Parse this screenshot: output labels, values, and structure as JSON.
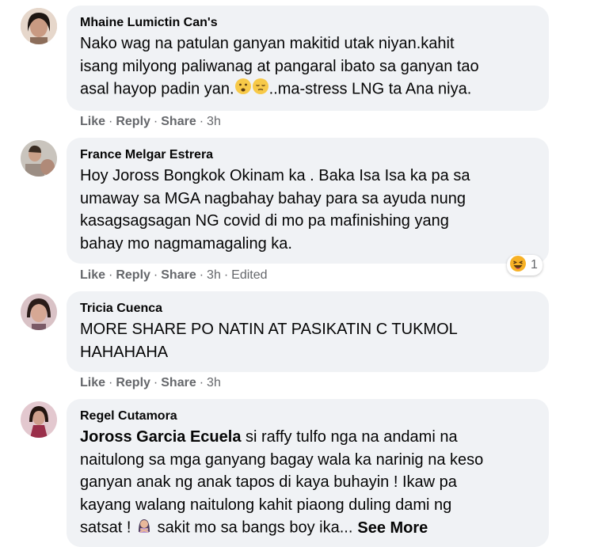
{
  "comments": [
    {
      "author": "Mhaine Lumictin Can's",
      "lines": [
        "Nako wag na patulan ganyan makitid utak niyan.kahit",
        "isang milyong paliwanag at pangaral ibato sa ganyan tao"
      ],
      "last_line_pre": "asal hayop padin yan.",
      "last_line_post": "..ma-stress LNG ta Ana niya.",
      "emojis": [
        "worried-face",
        "pensive-face"
      ],
      "actions": {
        "like": "Like",
        "reply": "Reply",
        "share": "Share",
        "time": "3h"
      }
    },
    {
      "author": "France Melgar Estrera",
      "lines": [
        "Hoy Joross Bongkok Okinam ka . Baka Isa Isa ka pa sa",
        "umaway sa MGA nagbahay bahay para sa ayuda nung",
        "kasagsagsagan NG covid di mo pa mafinishing yang",
        "bahay mo nagmamagaling ka."
      ],
      "actions": {
        "like": "Like",
        "reply": "Reply",
        "share": "Share",
        "time": "3h",
        "edited": "Edited"
      },
      "reaction": {
        "type": "haha",
        "count": "1"
      }
    },
    {
      "author": "Tricia Cuenca",
      "lines": [
        "MORE SHARE PO NATIN AT PASIKATIN C TUKMOL",
        "HAHAHAHA"
      ],
      "actions": {
        "like": "Like",
        "reply": "Reply",
        "share": "Share",
        "time": "3h"
      }
    },
    {
      "author": "Regel Cutamora",
      "mention": "Joross Garcia Ecuela",
      "first_line_rest": " si raffy tulfo nga na andami na",
      "lines": [
        "naitulong sa mga ganyang bagay wala ka narinig na keso",
        "ganyan anak ng anak tapos di kaya buhayin ! Ikaw pa",
        "kayang walang naitulong kahit piaong duling dami ng"
      ],
      "last_line_pre": "satsat ! ",
      "last_line_post": " sakit mo sa bangs boy ika...",
      "see_more": "See More",
      "emojis": [
        "person-gesturing-no"
      ]
    }
  ],
  "separator": "·",
  "colors": {
    "bubble": "#f0f2f5",
    "meta": "#65676b",
    "text": "#050505",
    "haha": "#f7b125"
  }
}
